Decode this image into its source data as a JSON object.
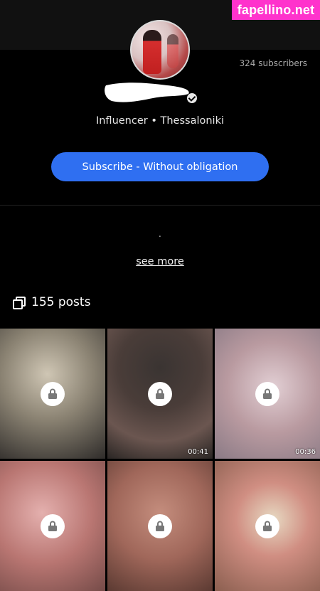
{
  "watermark": "fapellino.net",
  "profile": {
    "subscribers": "324 subscribers",
    "tagline": "Influencer • Thessaloniki",
    "subscribe_label": "Subscribe - Without obligation",
    "bio": ".",
    "see_more": "see more",
    "posts_label": "155 posts"
  },
  "grid": [
    {
      "duration": "",
      "bg": "radial-gradient(circle at 45% 35%, #cfc6b4 0%, #8a8272 45%, #2f2c2a 100%)"
    },
    {
      "duration": "00:41",
      "bg": "radial-gradient(circle at 50% 30%, #3a3432 0%, #4a3d39 40%, #6b5650 70%, #2a2624 100%)"
    },
    {
      "duration": "00:36",
      "bg": "radial-gradient(circle at 55% 45%, #e2cfd4 0%, #b99aa0 50%, #8a7a85 100%)"
    },
    {
      "duration": "",
      "bg": "radial-gradient(circle at 40% 40%, #e4b0ae 0%, #b97672 50%, #754b48 100%)"
    },
    {
      "duration": "",
      "bg": "radial-gradient(circle at 50% 40%, #c48d7d 0%, #a0675a 50%, #5b3a32 100%)"
    },
    {
      "duration": "",
      "bg": "radial-gradient(circle at 55% 45%, #e7d9c2 0%, #d08e82 40%, #8b5f50 100%)"
    }
  ]
}
